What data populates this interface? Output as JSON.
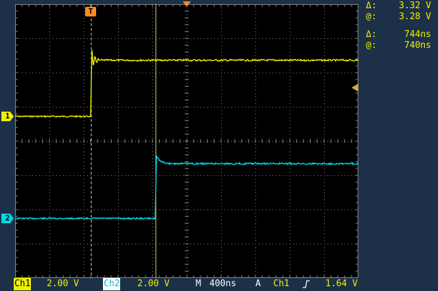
{
  "readouts": {
    "voltage_delta_symbol": "Δ:",
    "voltage_delta_value": "3.32 V",
    "voltage_at_symbol": "@:",
    "voltage_at_value": "3.28 V",
    "time_delta_symbol": "Δ:",
    "time_delta_value": "744ns",
    "time_at_symbol": "@:",
    "time_at_value": "740ns"
  },
  "markers": {
    "trigger_label": "T",
    "ch1_ref_label": "1",
    "ch2_ref_label": "2"
  },
  "status": {
    "ch1_label": "Ch1",
    "ch1_scale": "2.00 V",
    "ch2_label": "Ch2",
    "ch2_scale": "2.00 V",
    "timebase_mode": "M",
    "timebase": "400ns",
    "acq_mode": "A",
    "trigger_source": "Ch1",
    "trigger_slope_icon": "rising-edge-icon",
    "trigger_level": "1.64 V"
  },
  "colors": {
    "ch1": "#f0f000",
    "ch2": "#00d8e0",
    "trigger": "#ff8c1a",
    "background": "#1c3048"
  }
}
